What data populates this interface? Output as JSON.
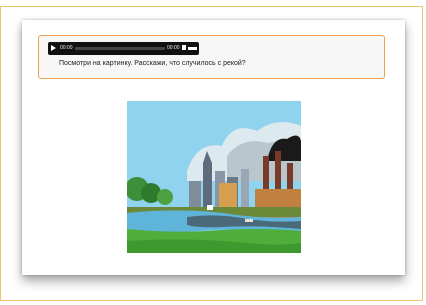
{
  "player": {
    "current_time": "00:00",
    "duration": "00:00"
  },
  "task": {
    "prompt": "Посмотри на картинку. Расскажи, что случилось с рекой?"
  },
  "colors": {
    "frame_border": "#f2c46a",
    "task_border": "#f0a050",
    "sky": "#8fd3ef",
    "smoke": "#1a1a1a",
    "river": "#5fb4d9",
    "grass": "#4fae3a"
  }
}
